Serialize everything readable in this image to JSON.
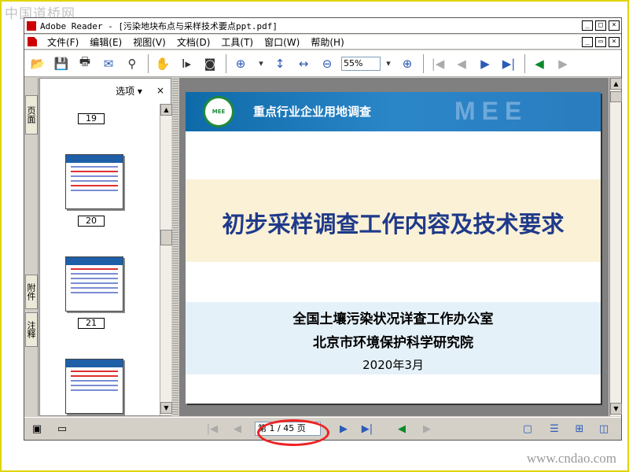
{
  "watermark": {
    "top": "中国道桥网",
    "bottom": "www.cndao.com"
  },
  "window": {
    "title": "Adobe Reader - [污染地块布点与采样技术要点ppt.pdf]",
    "buttons": [
      "_",
      "□",
      "×"
    ],
    "inner_buttons": [
      "_",
      "▭",
      "×"
    ]
  },
  "menu": [
    "文件(F)",
    "编辑(E)",
    "视图(V)",
    "文档(D)",
    "工具(T)",
    "窗口(W)",
    "帮助(H)"
  ],
  "toolbar": {
    "zoom_value": "55%"
  },
  "navtabs": [
    "页面",
    "附件",
    "注释"
  ],
  "sidepanel": {
    "options_label": "选项 ▾",
    "close": "×",
    "page_numbers": [
      "19",
      "20",
      "21"
    ]
  },
  "slide": {
    "header_title": "重点行业企业用地调查",
    "header_watermark": "MEE",
    "logo_text": "MEE",
    "main_title": "初步采样调查工作内容及技术要求",
    "org1": "全国土壤污染状况详查工作办公室",
    "org2": "北京市环境保护科学研究院",
    "date": "2020年3月"
  },
  "statusbar": {
    "page_indicator": "第 1 / 45 页"
  },
  "colors": {
    "header_blue": "#1f6fb5",
    "title_color": "#1f3a8a",
    "highlight_red": "#e22222",
    "frame_yellow": "#e0d400"
  }
}
